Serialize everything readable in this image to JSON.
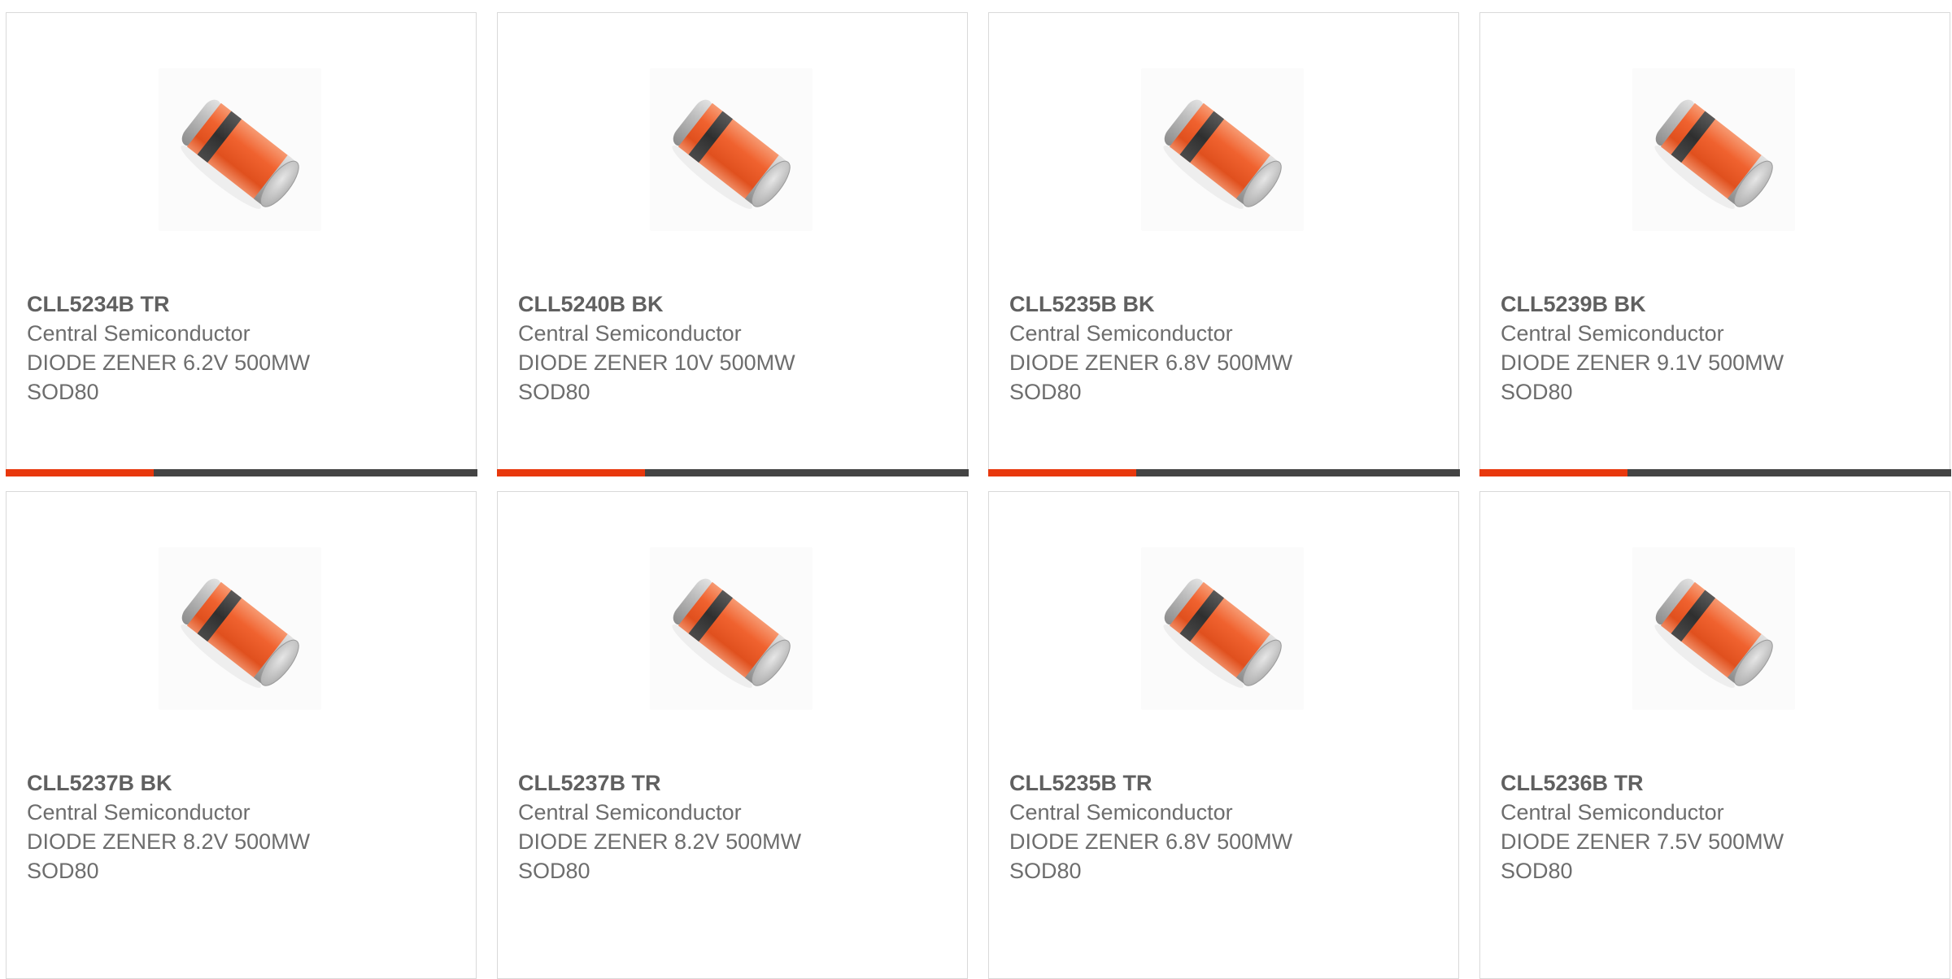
{
  "accent_color": "#e8380d",
  "bar_color": "#444444",
  "products": [
    {
      "part": "CLL5234B TR",
      "manufacturer": "Central Semiconductor",
      "description": "DIODE ZENER 6.2V 500MW",
      "package": "SOD80",
      "image_icon": "zener-diode-icon"
    },
    {
      "part": "CLL5240B BK",
      "manufacturer": "Central Semiconductor",
      "description": "DIODE ZENER 10V 500MW",
      "package": "SOD80",
      "image_icon": "zener-diode-icon"
    },
    {
      "part": "CLL5235B BK",
      "manufacturer": "Central Semiconductor",
      "description": "DIODE ZENER 6.8V 500MW",
      "package": "SOD80",
      "image_icon": "zener-diode-icon"
    },
    {
      "part": "CLL5239B BK",
      "manufacturer": "Central Semiconductor",
      "description": "DIODE ZENER 9.1V 500MW",
      "package": "SOD80",
      "image_icon": "zener-diode-icon"
    },
    {
      "part": "CLL5237B BK",
      "manufacturer": "Central Semiconductor",
      "description": "DIODE ZENER 8.2V 500MW",
      "package": "SOD80",
      "image_icon": "zener-diode-icon"
    },
    {
      "part": "CLL5237B TR",
      "manufacturer": "Central Semiconductor",
      "description": "DIODE ZENER 8.2V 500MW",
      "package": "SOD80",
      "image_icon": "zener-diode-icon"
    },
    {
      "part": "CLL5235B TR",
      "manufacturer": "Central Semiconductor",
      "description": "DIODE ZENER 6.8V 500MW",
      "package": "SOD80",
      "image_icon": "zener-diode-icon"
    },
    {
      "part": "CLL5236B TR",
      "manufacturer": "Central Semiconductor",
      "description": "DIODE ZENER 7.5V 500MW",
      "package": "SOD80",
      "image_icon": "zener-diode-icon"
    }
  ]
}
